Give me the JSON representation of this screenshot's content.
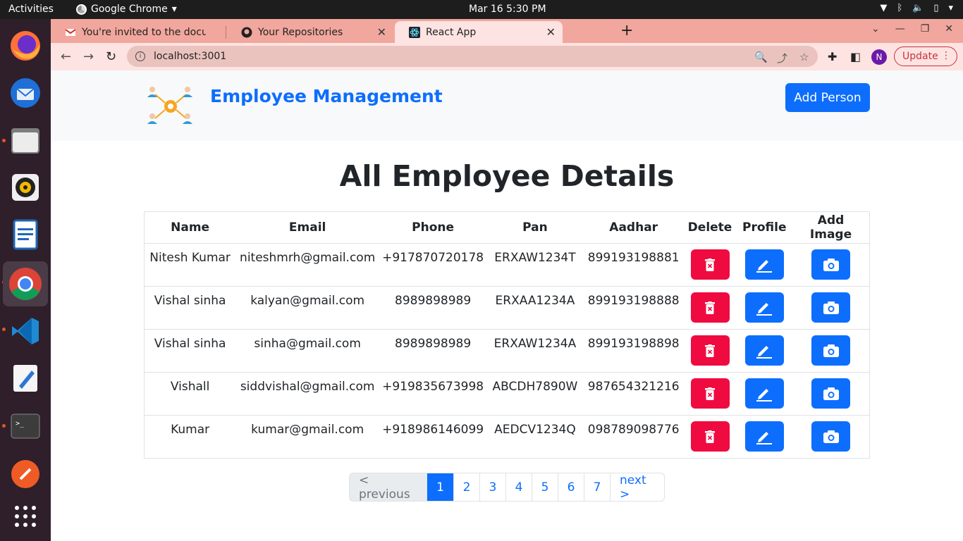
{
  "system": {
    "activities": "Activities",
    "app_name": "Google Chrome",
    "clock": "Mar 16   5:30 PM"
  },
  "browser": {
    "tabs": [
      {
        "title": "You're invited to the docu",
        "icon": "gmail-icon"
      },
      {
        "title": "Your Repositories",
        "icon": "github-icon"
      },
      {
        "title": "React App",
        "icon": "react-icon",
        "active": true
      }
    ],
    "url": "localhost:3001",
    "profile_initial": "N",
    "update_label": "Update"
  },
  "app": {
    "brand": "Employee Management",
    "add_person_label": "Add Person",
    "heading": "All Employee Details",
    "table": {
      "headers": [
        "Name",
        "Email",
        "Phone",
        "Pan",
        "Aadhar",
        "Delete",
        "Profile",
        "Add Image"
      ],
      "rows": [
        {
          "name": "Nitesh Kumar",
          "email": "niteshmrh@gmail.com",
          "phone": "+917870720178",
          "pan": "ERXAW1234T",
          "aadhar": "899193198881"
        },
        {
          "name": "Vishal sinha",
          "email": "kalyan@gmail.com",
          "phone": "8989898989",
          "pan": "ERXAA1234A",
          "aadhar": "899193198888"
        },
        {
          "name": "Vishal sinha",
          "email": "sinha@gmail.com",
          "phone": "8989898989",
          "pan": "ERXAW1234A",
          "aadhar": "899193198898"
        },
        {
          "name": "Vishall",
          "email": "siddvishal@gmail.com",
          "phone": "+919835673998",
          "pan": "ABCDH7890W",
          "aadhar": "987654321216"
        },
        {
          "name": "Kumar",
          "email": "kumar@gmail.com",
          "phone": "+918986146099",
          "pan": "AEDCV1234Q",
          "aadhar": "098789098776"
        }
      ]
    },
    "pagination": {
      "previous": "< previous",
      "pages": [
        "1",
        "2",
        "3",
        "4",
        "5",
        "6",
        "7"
      ],
      "current": "1",
      "next": "next >"
    }
  },
  "colors": {
    "primary": "#0d6efd",
    "danger": "#ef0b40",
    "tab_strip": "#f1a79d",
    "toolbar": "#fde3e1"
  }
}
